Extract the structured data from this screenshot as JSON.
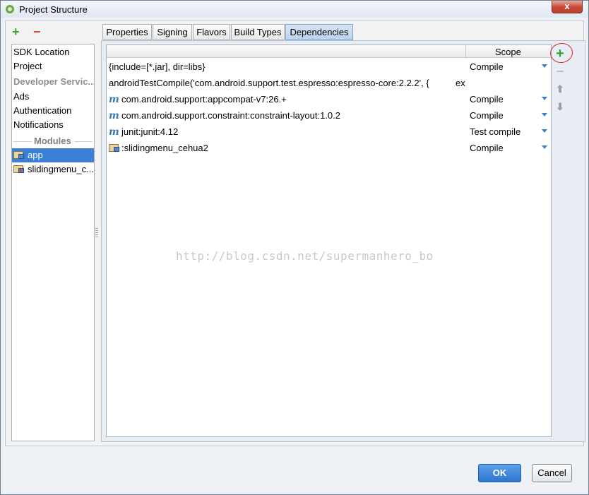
{
  "window": {
    "title": "Project Structure",
    "close_label": "x"
  },
  "left_panel": {
    "add_label": "+",
    "remove_label": "−",
    "items": [
      {
        "label": "SDK Location"
      },
      {
        "label": "Project"
      },
      {
        "label": "Developer Servic..."
      },
      {
        "label": "Ads"
      },
      {
        "label": "Authentication"
      },
      {
        "label": "Notifications"
      }
    ],
    "modules_header": "Modules",
    "modules": [
      {
        "label": "app",
        "selected": true
      },
      {
        "label": "slidingmenu_c..."
      }
    ]
  },
  "tabs": [
    {
      "label": "Properties"
    },
    {
      "label": "Signing"
    },
    {
      "label": "Flavors"
    },
    {
      "label": "Build Types"
    },
    {
      "label": "Dependencies",
      "active": true
    }
  ],
  "table": {
    "columns": {
      "name": "",
      "scope": "Scope"
    },
    "rows": [
      {
        "icon": "none",
        "name": "{include=[*.jar], dir=libs}",
        "scope": "Compile"
      },
      {
        "icon": "none",
        "name": "androidTestCompile('com.android.support.test.espresso:espresso-core:2.2.2', {",
        "scope": "exc"
      },
      {
        "icon": "maven-icon",
        "name": "com.android.support:appcompat-v7:26.+",
        "scope": "Compile"
      },
      {
        "icon": "maven-icon",
        "name": "com.android.support.constraint:constraint-layout:1.0.2",
        "scope": "Compile"
      },
      {
        "icon": "maven-icon",
        "name": "junit:junit:4.12",
        "scope": "Test compile"
      },
      {
        "icon": "module-icon",
        "name": ":slidingmenu_cehua2",
        "scope": "Compile"
      }
    ],
    "maven_glyph": "m"
  },
  "side_tools": {
    "add": "+",
    "remove": "−",
    "up": "⬆",
    "down": "⬇"
  },
  "watermark": "http://blog.csdn.net/supermanhero_bo",
  "buttons": {
    "ok": "OK",
    "cancel": "Cancel"
  },
  "colors": {
    "accent": "#3b7fd4",
    "add_green": "#35a335",
    "remove_red": "#d7402a",
    "annotation_red": "#e02020"
  }
}
